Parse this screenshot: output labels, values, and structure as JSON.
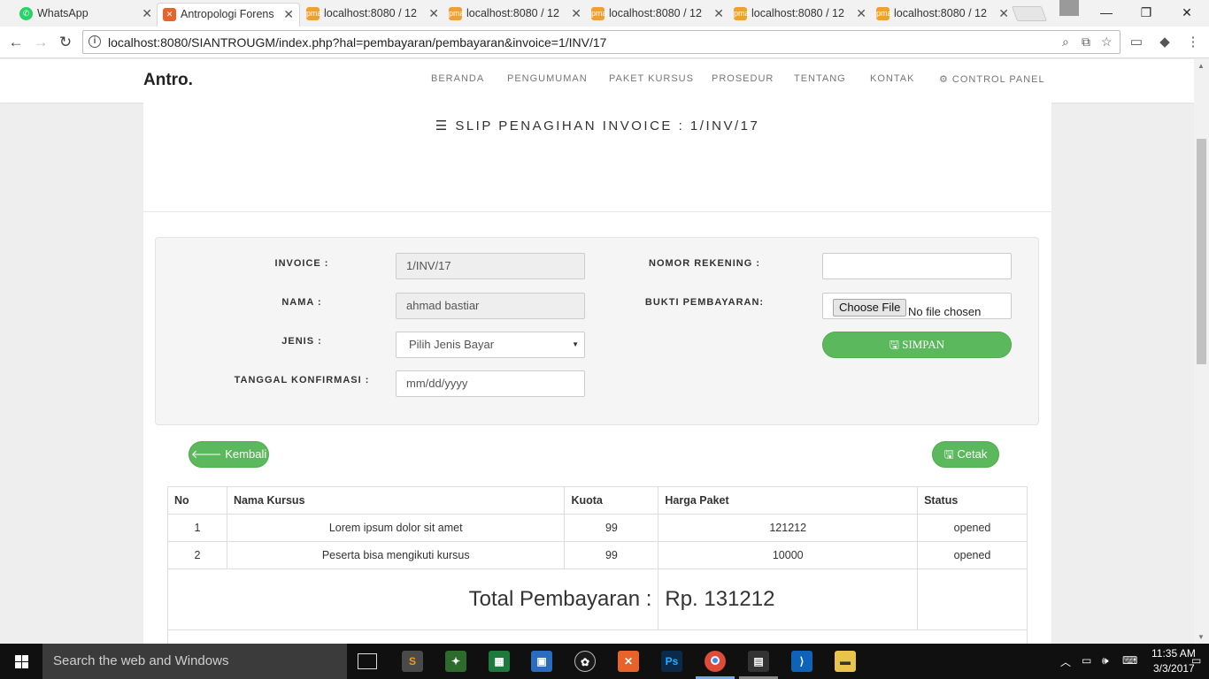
{
  "browser": {
    "tabs": [
      {
        "title": "WhatsApp",
        "favicon": "whatsapp-icon",
        "color": "#25d366"
      },
      {
        "title": "Antropologi Forens",
        "favicon": "xampp-icon",
        "color": "#e8632b"
      },
      {
        "title": "localhost:8080 / 12",
        "favicon": "phpmyadmin-icon",
        "color": "#f0a030"
      },
      {
        "title": "localhost:8080 / 12",
        "favicon": "phpmyadmin-icon",
        "color": "#f0a030"
      },
      {
        "title": "localhost:8080 / 12",
        "favicon": "phpmyadmin-icon",
        "color": "#f0a030"
      },
      {
        "title": "localhost:8080 / 12",
        "favicon": "phpmyadmin-icon",
        "color": "#f0a030"
      },
      {
        "title": "localhost:8080 / 12",
        "favicon": "phpmyadmin-icon",
        "color": "#f0a030"
      }
    ],
    "url": "localhost:8080/SIANTROUGM/index.php?hal=pembayaran/pembayaran&invoice=1/INV/17"
  },
  "site": {
    "brand": "Antro.",
    "menu": [
      "BERANDA",
      "PENGUMUMAN",
      "PAKET KURSUS",
      "PROSEDUR",
      "TENTANG",
      "KONTAK",
      "CONTROL PANEL"
    ]
  },
  "slip": {
    "title": "SLIP PENAGIHAN INVOICE : 1/INV/17"
  },
  "form": {
    "invoice_label": "INVOICE :",
    "invoice_value": "1/INV/17",
    "nama_label": "NAMA :",
    "nama_value": "ahmad bastiar",
    "jenis_label": "JENIS :",
    "jenis_value": "Pilih Jenis Bayar",
    "tanggal_label": "TANGGAL KONFIRMASI :",
    "tanggal_placeholder": "mm/dd/yyyy",
    "rekening_label": "NOMOR REKENING :",
    "rekening_value": "",
    "bukti_label": "BUKTI PEMBAYARAN:",
    "file_button": "Choose File",
    "file_status": "No file chosen",
    "simpan_label": "SIMPAN"
  },
  "actions": {
    "kembali_label": "Kembali",
    "cetak_label": "Cetak"
  },
  "table": {
    "headers": [
      "No",
      "Nama Kursus",
      "Kuota",
      "Harga Paket",
      "Status"
    ],
    "rows": [
      [
        "1",
        "Lorem ipsum dolor sit amet",
        "99",
        "121212",
        "opened"
      ],
      [
        "2",
        "Peserta bisa mengikuti kursus",
        "99",
        "10000",
        "opened"
      ]
    ],
    "total_label": "Total Pembayaran :",
    "total_value": "Rp. 131212"
  },
  "taskbar": {
    "search_placeholder": "Search the web and Windows",
    "time": "11:35 AM",
    "date": "3/3/2017"
  },
  "colors": {
    "accent_green": "#5cb85c",
    "taskbar": "#101010"
  }
}
